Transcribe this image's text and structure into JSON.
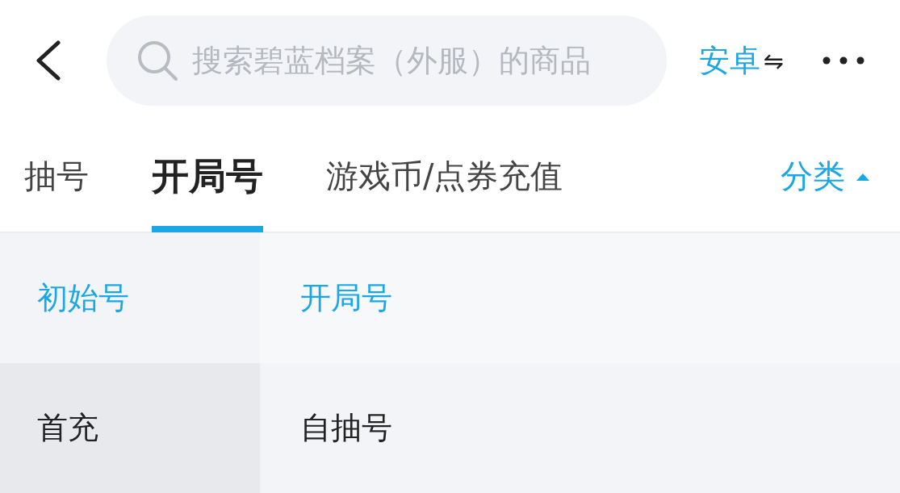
{
  "search": {
    "placeholder": "搜索碧蓝档案（外服）的商品"
  },
  "platform": {
    "label": "安卓",
    "icon": "⇋"
  },
  "tabs": [
    {
      "label": "抽号",
      "selected": false
    },
    {
      "label": "开局号",
      "selected": true
    },
    {
      "label": "游戏币/点券充值",
      "selected": false
    }
  ],
  "category_toggle": {
    "label": "分类",
    "expanded": true
  },
  "categories": [
    {
      "label": "初始号",
      "selected": true
    },
    {
      "label": "首充",
      "selected": false
    }
  ],
  "subcategories": [
    {
      "label": "开局号",
      "selected": true
    },
    {
      "label": "自抽号",
      "selected": false
    }
  ]
}
